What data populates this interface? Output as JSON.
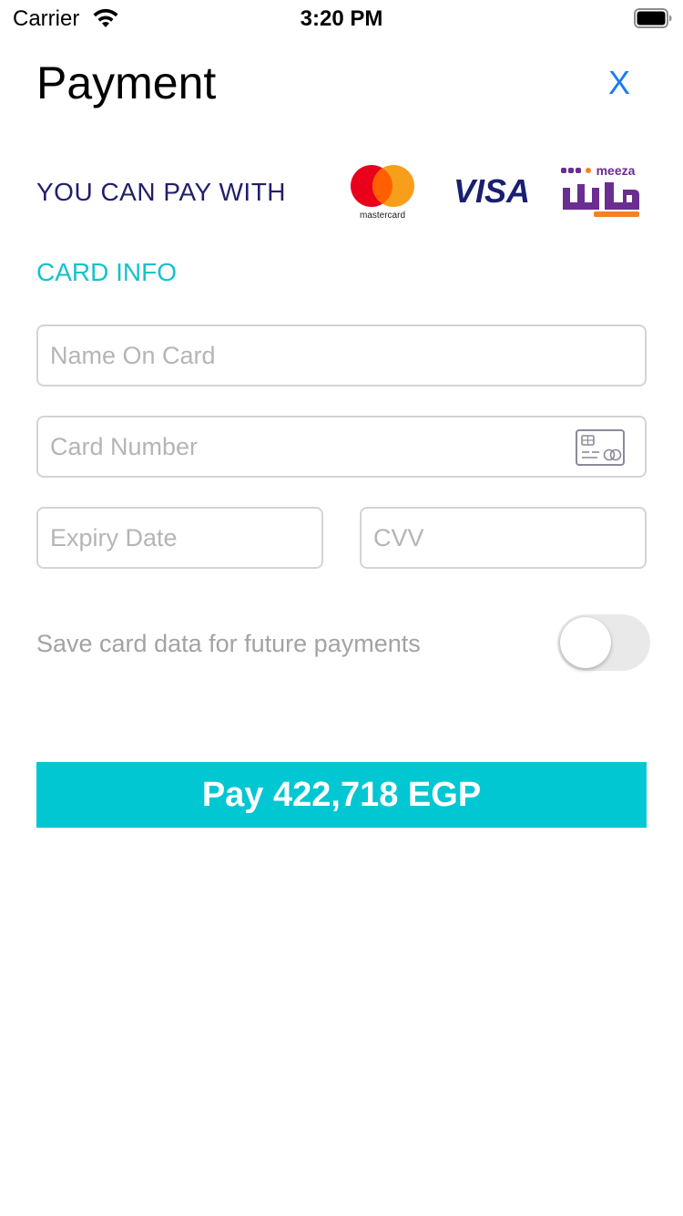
{
  "status_bar": {
    "carrier": "Carrier",
    "time": "3:20 PM",
    "icons": [
      "wifi-icon",
      "battery-icon"
    ]
  },
  "header": {
    "title": "Payment",
    "close_label": "X",
    "close_color": "#1a7cf5"
  },
  "payment_methods": {
    "label": "YOU CAN PAY WITH",
    "logos": [
      {
        "name": "mastercard",
        "text": "mastercard"
      },
      {
        "name": "visa",
        "text": "VISA"
      },
      {
        "name": "meeza",
        "text": "meeza"
      }
    ]
  },
  "card_info": {
    "heading": "CARD INFO",
    "fields": {
      "name": {
        "placeholder": "Name On Card",
        "value": ""
      },
      "number": {
        "placeholder": "Card Number",
        "value": ""
      },
      "expiry": {
        "placeholder": "Expiry Date",
        "value": ""
      },
      "cvv": {
        "placeholder": "CVV",
        "value": ""
      }
    }
  },
  "save_card": {
    "label": "Save card data for future payments",
    "enabled": false
  },
  "pay_button": {
    "label": "Pay 422,718 EGP",
    "color": "#00c7d2"
  },
  "colors": {
    "accent": "#14c2cc",
    "primary_text": "#221f6b"
  }
}
